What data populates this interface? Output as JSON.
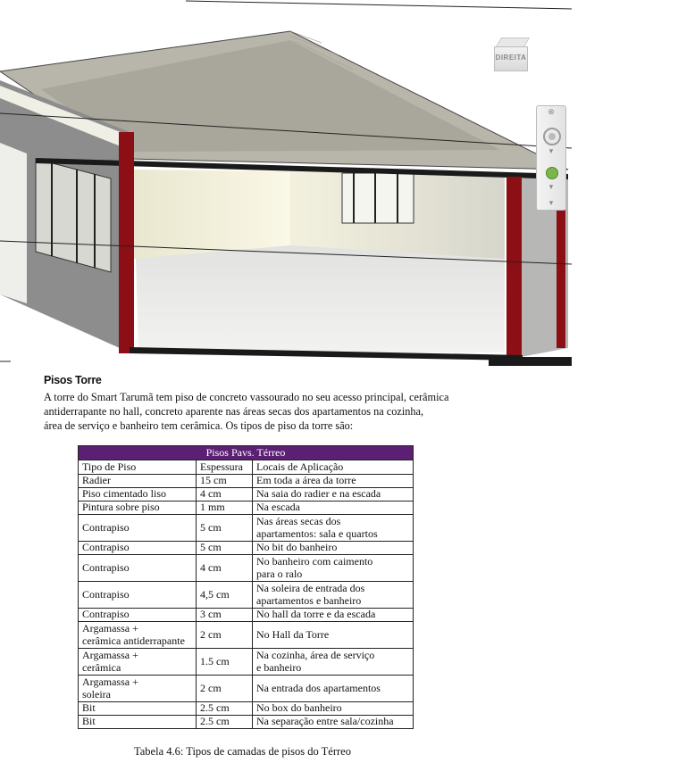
{
  "viewport": {
    "viewcube_label": "DIREITA",
    "viewcube_icon": "view-cube-icon",
    "navbar": {
      "close_icon": "close-icon",
      "wheel_icon": "steering-wheel-icon",
      "chevron_icon": "chevron-down-icon",
      "zoom_icon": "zoom-icon",
      "colors": {
        "pillar": "#8b0f14",
        "roof": "#b7b5a8",
        "floor": "#e6e6e4",
        "wall": "#8c8c8c"
      }
    }
  },
  "section": {
    "title": "Pisos Torre",
    "lines": [
      "A torre do Smart Tarumã tem piso de concreto vassourado no seu acesso principal, cerâmica",
      "antiderrapante no hall, concreto aparente nas áreas secas dos apartamentos na cozinha,",
      "área de serviço e banheiro tem cerâmica.  Os tipos de piso da torre são:"
    ]
  },
  "table": {
    "title": "Pisos Pavs. Térreo",
    "header_color": "#5b1f73",
    "columns": [
      "Tipo de Piso",
      "Espessura",
      "Locais de Aplicação"
    ],
    "rows": [
      {
        "tipo": [
          "Radier"
        ],
        "espessura": "15 cm",
        "locais": [
          "Em toda a área da torre"
        ]
      },
      {
        "tipo": [
          "Piso cimentado liso"
        ],
        "espessura": "4 cm",
        "locais": [
          "Na saia do radier e na escada"
        ]
      },
      {
        "tipo": [
          "Pintura sobre piso"
        ],
        "espessura": "1 mm",
        "locais": [
          "Na escada"
        ]
      },
      {
        "tipo": [
          "Contrapiso"
        ],
        "espessura": "5 cm",
        "locais": [
          "Nas áreas secas dos",
          "apartamentos: sala e quartos"
        ]
      },
      {
        "tipo": [
          "Contrapiso"
        ],
        "espessura": "5 cm",
        "locais": [
          "No bit do banheiro"
        ]
      },
      {
        "tipo": [
          "Contrapiso"
        ],
        "espessura": "4 cm",
        "locais": [
          "No banheiro com caimento",
          "para o ralo"
        ]
      },
      {
        "tipo": [
          "Contrapiso"
        ],
        "espessura": "4,5 cm",
        "locais": [
          "Na soleira de entrada dos",
          "apartamentos e banheiro"
        ]
      },
      {
        "tipo": [
          "Contrapiso"
        ],
        "espessura": "3 cm",
        "locais": [
          "No hall da torre e da escada"
        ]
      },
      {
        "tipo": [
          "Argamassa +",
          "cerâmica antiderrapante"
        ],
        "espessura": "2 cm",
        "locais": [
          "No Hall da Torre"
        ]
      },
      {
        "tipo": [
          "Argamassa +",
          "cerâmica"
        ],
        "espessura": "1.5 cm",
        "locais": [
          "Na cozinha, área de serviço",
          "e banheiro"
        ]
      },
      {
        "tipo": [
          "Argamassa +",
          "soleira"
        ],
        "espessura": "2 cm",
        "locais": [
          "Na entrada dos apartamentos"
        ]
      },
      {
        "tipo": [
          "Bit"
        ],
        "espessura": "2.5 cm",
        "locais": [
          "No box do banheiro"
        ]
      },
      {
        "tipo": [
          "Bit"
        ],
        "espessura": "2.5 cm",
        "locais": [
          "Na separação entre sala/cozinha"
        ]
      }
    ],
    "caption": "Tabela 4.6: Tipos de camadas de pisos do Térreo"
  }
}
